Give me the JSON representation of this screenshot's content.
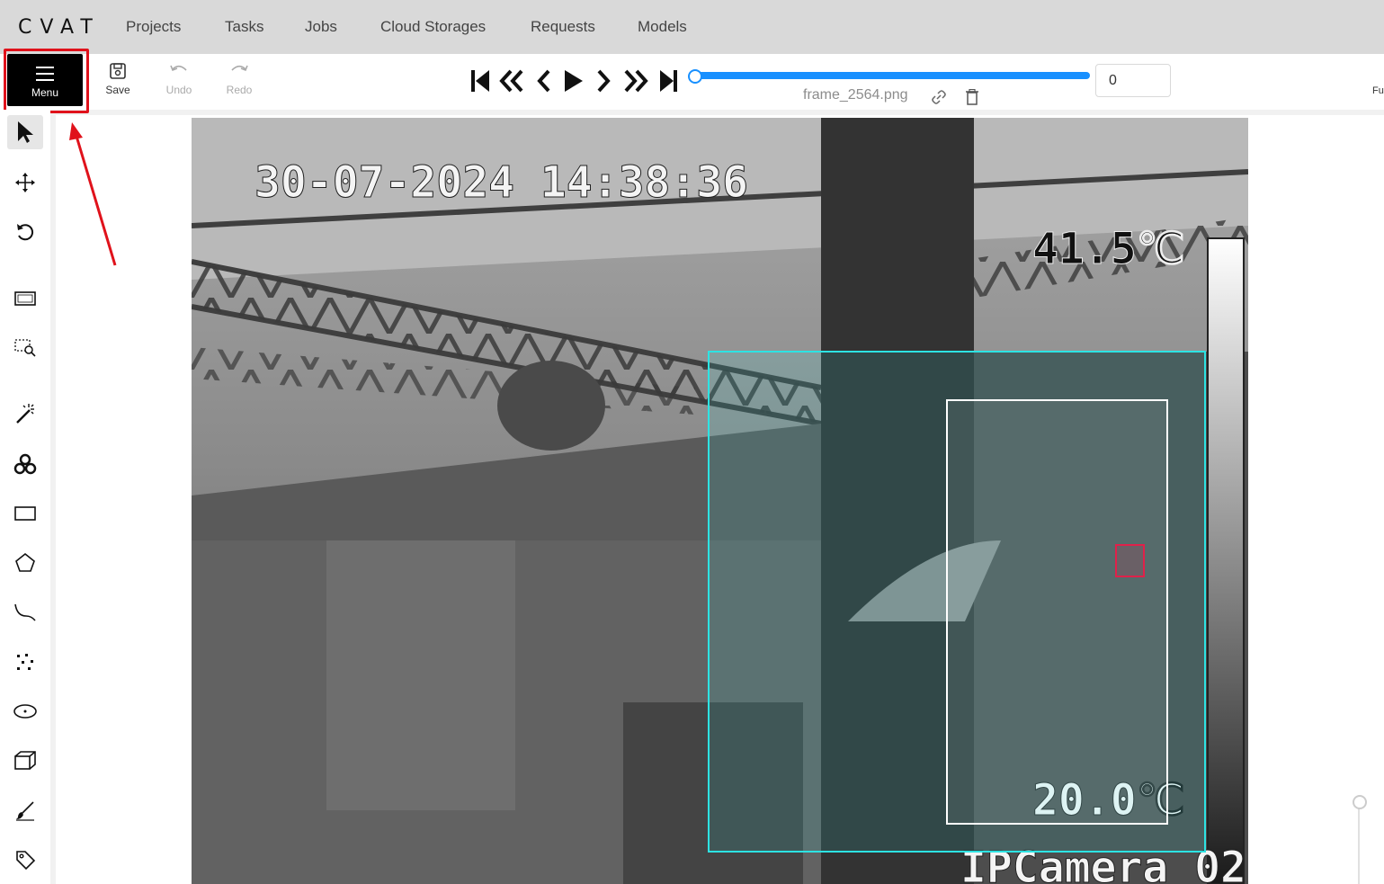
{
  "app": {
    "logo": "CVAT"
  },
  "nav": [
    {
      "label": "Projects"
    },
    {
      "label": "Tasks"
    },
    {
      "label": "Jobs"
    },
    {
      "label": "Cloud Storages"
    },
    {
      "label": "Requests"
    },
    {
      "label": "Models"
    }
  ],
  "toolbar": {
    "menu_label": "Menu",
    "save_label": "Save",
    "undo_label": "Undo",
    "redo_label": "Redo",
    "frame_filename": "frame_2564.png",
    "frame_number": "0",
    "fullscreen_label_partial": "Fu"
  },
  "player": {
    "buttons": [
      "first-frame-icon",
      "fast-backward-icon",
      "previous-icon",
      "play-icon",
      "next-icon",
      "fast-forward-icon",
      "last-frame-icon"
    ],
    "progress": 1.0
  },
  "sidebar_tools": [
    "cursor-icon",
    "move-icon",
    "rotate-icon",
    "fit-icon",
    "zoom-region-icon",
    "magic-wand-icon",
    "openvino-icon",
    "rectangle-icon",
    "polygon-icon",
    "polyline-icon",
    "points-icon",
    "ellipse-icon",
    "cuboid-icon",
    "brush-icon",
    "tag-icon"
  ],
  "canvas": {
    "overlay_datetime": "30-07-2024 14:38:36",
    "overlay_temp_max": "41.5℃",
    "overlay_temp_min": "20.0℃",
    "overlay_camera": "IPCamera 02",
    "colors": {
      "box_cyan": "#2de3e3",
      "box_white": "#ffffff",
      "box_red": "#e0214a",
      "highlight_red": "#e0121b"
    }
  }
}
